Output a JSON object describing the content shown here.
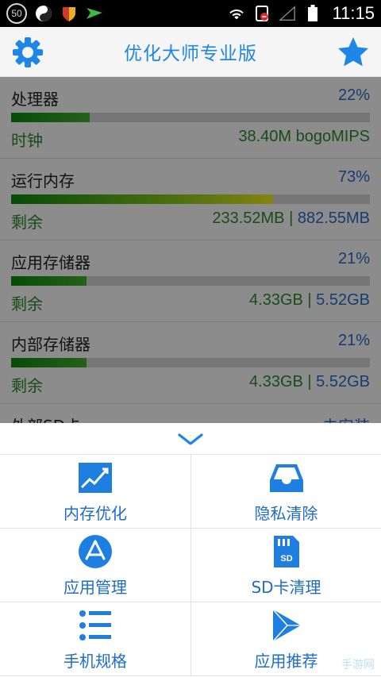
{
  "status_bar": {
    "notification_count": "50",
    "time": "11:15"
  },
  "appbar": {
    "title": "优化大师专业版",
    "left_icon": "gear-icon",
    "right_icon": "star-icon"
  },
  "stats": [
    {
      "name": "处理器",
      "percent": "22%",
      "level": 0.22,
      "bar": "green",
      "sub_label": "时钟",
      "sub_value": "38.40M bogoMIPS",
      "total": ""
    },
    {
      "name": "运行内存",
      "percent": "73%",
      "level": 0.73,
      "bar": "yellow",
      "sub_label": "剩余",
      "sub_value": "233.52MB",
      "total": "882.55MB"
    },
    {
      "name": "应用存储器",
      "percent": "21%",
      "level": 0.21,
      "bar": "green",
      "sub_label": "剩余",
      "sub_value": "4.33GB",
      "total": "5.52GB"
    },
    {
      "name": "内部存储器",
      "percent": "21%",
      "level": 0.21,
      "bar": "green",
      "sub_label": "剩余",
      "sub_value": "4.33GB",
      "total": "5.52GB"
    },
    {
      "name": "外部SD卡",
      "percent": "未安装"
    }
  ],
  "sheet": {
    "collapse_icon": "chevron-down-icon",
    "actions": [
      {
        "label": "内存优化",
        "icon": "chart-icon"
      },
      {
        "label": "隐私清除",
        "icon": "tray-icon"
      },
      {
        "label": "应用管理",
        "icon": "app-store-icon"
      },
      {
        "label": "SD卡清理",
        "icon": "sd-card-icon"
      },
      {
        "label": "手机规格",
        "icon": "list-icon"
      },
      {
        "label": "应用推荐",
        "icon": "play-icon"
      }
    ]
  },
  "watermark": "手游网",
  "colors": {
    "accent": "#1e86e6",
    "green": "#2e8b2e",
    "blue_value": "#2a6fc9"
  }
}
